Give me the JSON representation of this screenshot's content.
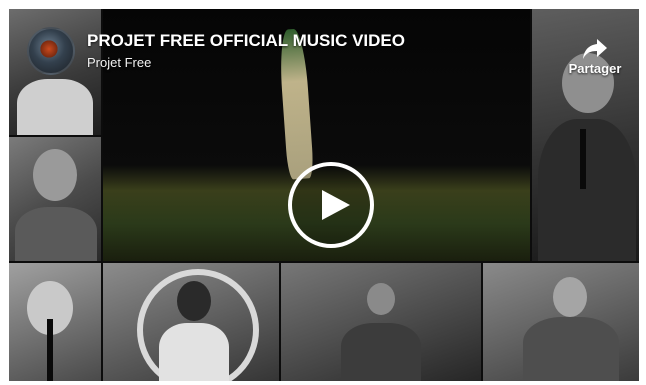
{
  "video": {
    "title": "PROJET FREE OFFICIAL MUSIC VIDEO",
    "channel": "Projet Free"
  },
  "share": {
    "label": "Partager",
    "icon": "share-arrow-icon"
  },
  "play_button": {
    "icon": "play-icon"
  },
  "channel_avatar": {
    "icon": "channel-avatar"
  },
  "colors": {
    "overlay_text": "#ffffff",
    "background": "#0c0c0c"
  }
}
